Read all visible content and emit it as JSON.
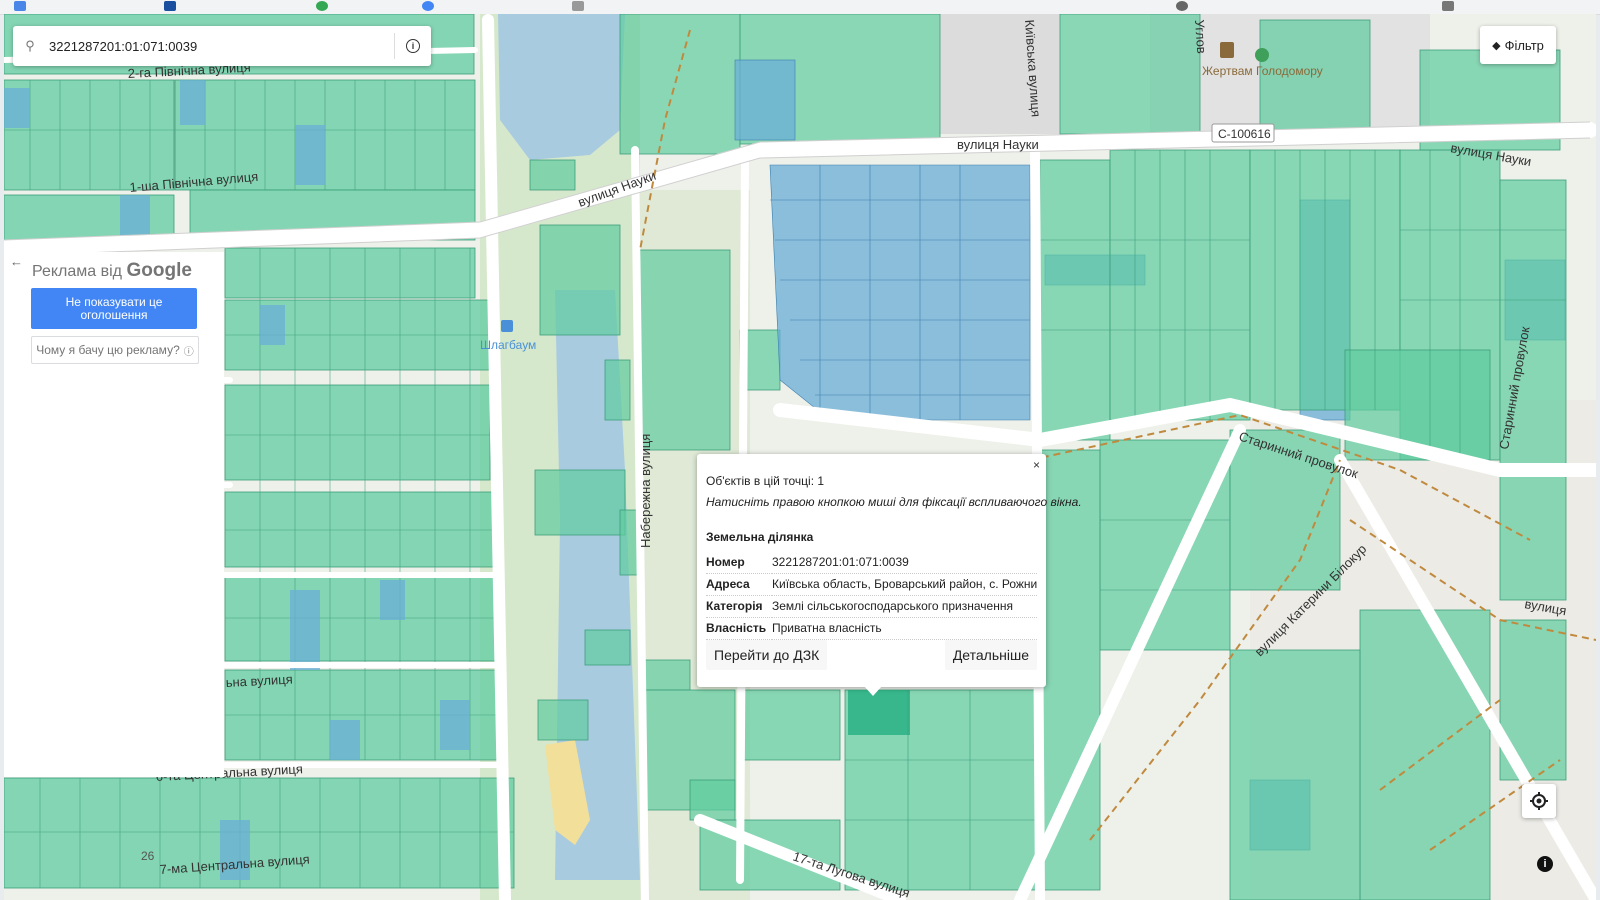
{
  "search": {
    "value": "3221287201:01:071:0039"
  },
  "filter": {
    "label": "Фільтр"
  },
  "map_labels": {
    "street_nauky_left": "вулиця Науки",
    "street_nauky_mid": "вулиця Науки",
    "street_nauky_right": "вулиця Науки",
    "road_code": "C-100616",
    "street_2_pivnichna": "2-га Північна вулиця",
    "street_1_pivnichna": "1-ша Північна вулиця",
    "naberezhna": "Набережна вулиця",
    "starynny": "Старинний провулок",
    "starynny_vertical": "Старинний провулок",
    "katerynyn": "вулиця Катерини Білокур",
    "lugova": "17-та Лугова вулиця",
    "centralna_6": "6-та Центральна вулиця",
    "centralna_7": "7-ма Центральна вулиця",
    "street_partial": "ьна вулиця",
    "street_right_edge": "вулиця",
    "kyivska_vertical": "Київська вулиця",
    "uglov": "Углов",
    "house_26": "26",
    "poi_victims": "Жертвам Голодомору",
    "poi_barrier": "Шлагбаум"
  },
  "ad": {
    "title_prefix": "Реклама від",
    "title_brand": "Google",
    "hide_button": "Не показувати це оголошення",
    "why_button": "Чому я бачу цю рекламу?"
  },
  "popup": {
    "objects_count": "Об'єктів в цій точці: 1",
    "hint": "Натисніть правою кнопкою миші для фіксації вспливаючого вікна.",
    "section": "Земельна ділянка",
    "rows": [
      {
        "key": "Номер",
        "value": "3221287201:01:071:0039"
      },
      {
        "key": "Адреса",
        "value": "Київська область, Броварський район, с. Рожни"
      },
      {
        "key": "Категорія",
        "value": "Землі сільськогосподарського призначення"
      },
      {
        "key": "Власність",
        "value": "Приватна власність"
      }
    ],
    "goto_button": "Перейти до ДЗК",
    "details_button": "Детальніше",
    "close": "×"
  },
  "colors": {
    "parcel_green": "#5fcca0",
    "parcel_blue": "#6aaed6",
    "water": "#a9cbe0",
    "road": "#ffffff",
    "path": "#c08a3e",
    "ad_button": "#4285f4"
  }
}
